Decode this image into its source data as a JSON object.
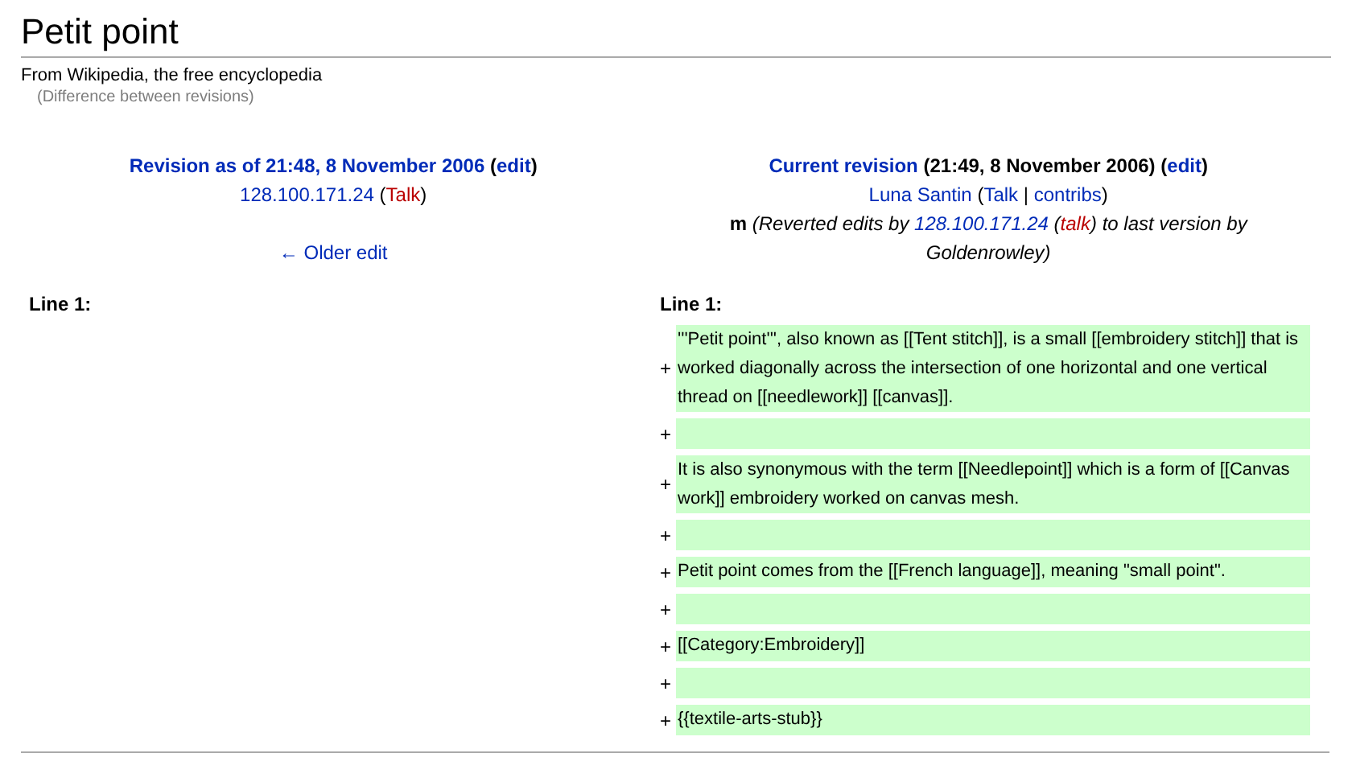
{
  "page": {
    "title": "Petit point",
    "tagline": "From Wikipedia, the free encyclopedia",
    "subtitle": "(Difference between revisions)"
  },
  "old_revision": {
    "lines": [
      [
        {
          "t": "Revision as of 21:48, 8 November 2006",
          "kind": "link",
          "bold": true
        },
        {
          "t": " (",
          "kind": "plain",
          "bold": true
        },
        {
          "t": "edit",
          "kind": "link",
          "bold": true
        },
        {
          "t": ")",
          "kind": "plain",
          "bold": true
        }
      ],
      [
        {
          "t": "128.100.171.24",
          "kind": "link"
        },
        {
          "t": " (",
          "kind": "plain"
        },
        {
          "t": "Talk",
          "kind": "redlink"
        },
        {
          "t": ")",
          "kind": "plain"
        }
      ]
    ],
    "nav_link": "← Older edit"
  },
  "new_revision": {
    "lines": [
      [
        {
          "t": "Current revision",
          "kind": "link",
          "bold": true
        },
        {
          "t": " (21:49, 8 November 2006) (",
          "kind": "plain",
          "bold": true
        },
        {
          "t": "edit",
          "kind": "link",
          "bold": true
        },
        {
          "t": ")",
          "kind": "plain",
          "bold": true
        }
      ],
      [
        {
          "t": "Luna Santin",
          "kind": "link"
        },
        {
          "t": " (",
          "kind": "plain"
        },
        {
          "t": "Talk",
          "kind": "link"
        },
        {
          "t": " | ",
          "kind": "plain"
        },
        {
          "t": "contribs",
          "kind": "link"
        },
        {
          "t": ")",
          "kind": "plain"
        }
      ],
      [
        {
          "t": "m",
          "kind": "plain",
          "bold": true
        },
        {
          "t": " (Reverted edits by ",
          "kind": "plain",
          "italic": true
        },
        {
          "t": "128.100.171.24",
          "kind": "link",
          "italic": true
        },
        {
          "t": " (",
          "kind": "plain",
          "italic": true
        },
        {
          "t": "talk",
          "kind": "redlink",
          "italic": true
        },
        {
          "t": ") to last version by Goldenrowley)",
          "kind": "plain",
          "italic": true
        }
      ]
    ]
  },
  "diff": {
    "left_heading": "Line 1:",
    "right_heading": "Line 1:",
    "added_lines": [
      {
        "sign": "+",
        "text": "'''Petit point''', also known as [[Tent stitch]], is a small [[embroidery stitch]] that is worked diagonally across the intersection of one horizontal and one vertical thread on [[needlework]] [[canvas]]."
      },
      {
        "sign": "+"
      },
      {
        "sign": "+",
        "text": "It is also synonymous with the term [[Needlepoint]] which is a form of [[Canvas work]] embroidery worked on canvas mesh."
      },
      {
        "sign": "+"
      },
      {
        "sign": "+",
        "text": "Petit point comes from the [[French language]], meaning \"small point\"."
      },
      {
        "sign": "+"
      },
      {
        "sign": "+",
        "text": "[[Category:Embroidery]]"
      },
      {
        "sign": "+"
      },
      {
        "sign": "+",
        "text": "{{textile-arts-stub}}"
      }
    ]
  }
}
